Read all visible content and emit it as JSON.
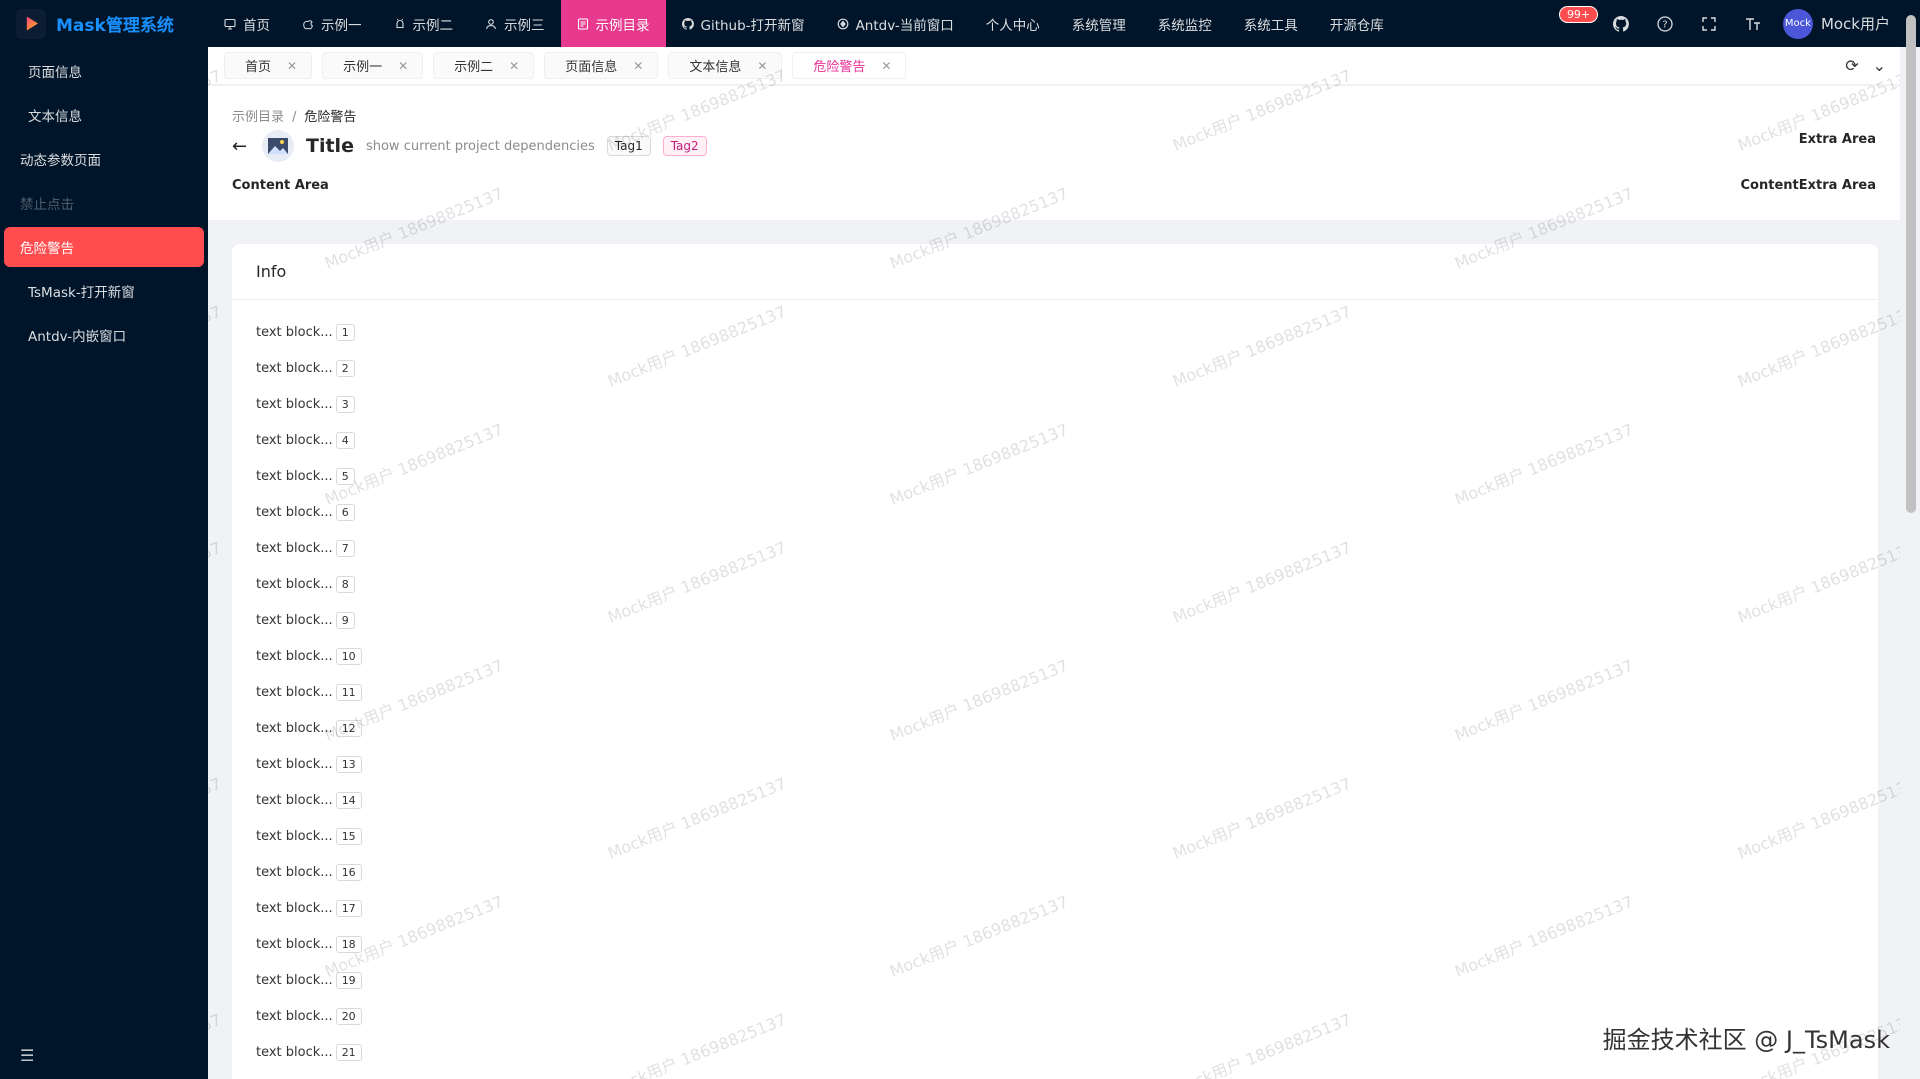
{
  "app": {
    "name": "Mask管理系统"
  },
  "topnav": {
    "items": [
      {
        "label": "首页",
        "icon": "monitor-icon"
      },
      {
        "label": "示例一",
        "icon": "apple-icon"
      },
      {
        "label": "示例二",
        "icon": "android-icon"
      },
      {
        "label": "示例三",
        "icon": "user-icon"
      },
      {
        "label": "示例目录",
        "icon": "file-icon",
        "active": true
      },
      {
        "label": "Github-打开新窗",
        "icon": "github-icon"
      },
      {
        "label": "Antdv-当前窗口",
        "icon": "ant-icon"
      },
      {
        "label": "个人中心"
      },
      {
        "label": "系统管理"
      },
      {
        "label": "系统监控"
      },
      {
        "label": "系统工具"
      },
      {
        "label": "开源仓库"
      }
    ],
    "badge": "99+",
    "avatar_text": "Mock",
    "user_name": "Mock用户"
  },
  "sidebar": {
    "items": [
      {
        "label": "页面信息",
        "icon": "monitor-icon"
      },
      {
        "label": "文本信息",
        "icon": "doc-icon"
      },
      {
        "label": "动态参数页面"
      },
      {
        "label": "禁止点击",
        "disabled": true
      },
      {
        "label": "危险警告",
        "active": true
      },
      {
        "label": "TsMask-打开新窗",
        "icon": "github-icon"
      },
      {
        "label": "Antdv-内嵌窗口",
        "icon": "ant-icon"
      }
    ]
  },
  "tabs": [
    {
      "label": "首页",
      "icon": "monitor-icon"
    },
    {
      "label": "示例一",
      "icon": "apple-icon"
    },
    {
      "label": "示例二",
      "icon": "android-icon"
    },
    {
      "label": "页面信息",
      "icon": "monitor-icon"
    },
    {
      "label": "文本信息",
      "icon": "doc-icon"
    },
    {
      "label": "危险警告",
      "icon": "file-icon",
      "active": true
    }
  ],
  "breadcrumb": {
    "parent": "示例目录",
    "sep": "/",
    "current": "危险警告"
  },
  "pageheader": {
    "title": "Title",
    "subtitle": "show current project dependencies",
    "tag1": "Tag1",
    "tag2": "Tag2",
    "extra": "Extra Area",
    "content": "Content Area",
    "content_extra": "ContentExtra Area"
  },
  "card": {
    "title": "Info",
    "row_text": "text block...",
    "rows": [
      "1",
      "2",
      "3",
      "4",
      "5",
      "6",
      "7",
      "8",
      "9",
      "10",
      "11",
      "12",
      "13",
      "14",
      "15",
      "16",
      "17",
      "18",
      "19",
      "20",
      "21"
    ]
  },
  "watermark": "Mock用户 18698825137",
  "footer_mark": "掘金技术社区 @ J_TsMask",
  "colors": {
    "nav_bg": "#001529",
    "active_nav": "#e7398d",
    "active_side": "#ff4d4f",
    "brand": "#1890ff"
  }
}
